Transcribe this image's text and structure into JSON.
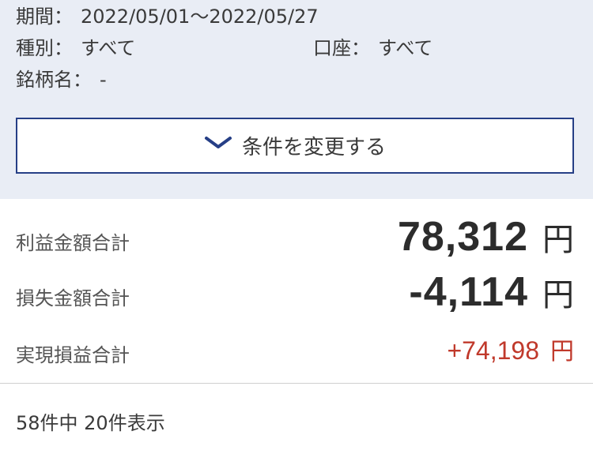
{
  "filters": {
    "period": {
      "label": "期間：",
      "value": "2022/05/01〜2022/05/27"
    },
    "type": {
      "label": "種別：",
      "value": "すべて"
    },
    "account": {
      "label": "口座：",
      "value": "すべて"
    },
    "stock": {
      "label": "銘柄名：",
      "value": "-"
    }
  },
  "change_button": {
    "label": "条件を変更する",
    "icon": "chevron-down-icon",
    "accent_color": "#263f86"
  },
  "summary": {
    "profit": {
      "label": "利益金額合計",
      "value": "78,312",
      "unit": "円"
    },
    "loss": {
      "label": "損失金額合計",
      "value": "-4,114",
      "unit": "円"
    },
    "realized": {
      "label": "実現損益合計",
      "value": "+74,198",
      "unit": "円",
      "color": "#c0392b"
    }
  },
  "result_count": "58件中 20件表示"
}
